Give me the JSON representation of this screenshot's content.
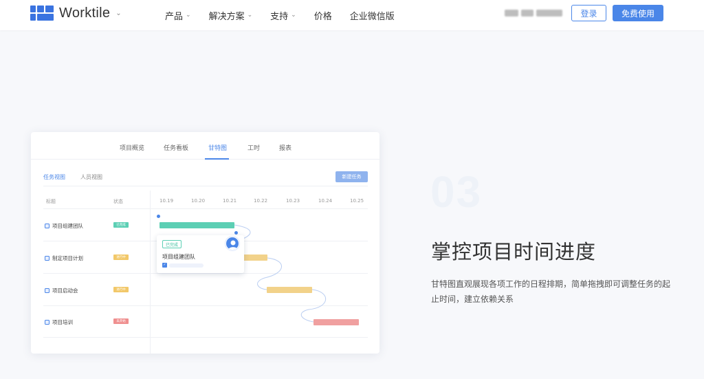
{
  "header": {
    "brand": "Worktile",
    "nav": [
      {
        "label": "产品",
        "has_menu": true
      },
      {
        "label": "解决方案",
        "has_menu": true
      },
      {
        "label": "支持",
        "has_menu": true
      },
      {
        "label": "价格",
        "has_menu": false
      },
      {
        "label": "企业微信版",
        "has_menu": false
      }
    ],
    "login_label": "登录",
    "free_label": "免费使用",
    "accent": "#4a86e8"
  },
  "card": {
    "tabs": [
      "项目概览",
      "任务看板",
      "甘特图",
      "工时",
      "报表"
    ],
    "active_tab": "甘特图",
    "views": [
      "任务视图",
      "人员视图"
    ],
    "active_view": "任务视图",
    "new_task_label": "新建任务",
    "columns": {
      "title": "标题",
      "status": "状态"
    },
    "dates": [
      "10.19",
      "10.20",
      "10.21",
      "10.22",
      "10.23",
      "10.24",
      "10.25"
    ],
    "tasks": [
      {
        "title": "项目组建团队",
        "status": "已完成",
        "status_color": "#5ccfb4",
        "bar_color": "#5ccfb4"
      },
      {
        "title": "制定项目计划",
        "status": "进行中",
        "status_color": "#f2c869",
        "bar_color": "#f2d28a"
      },
      {
        "title": "项目启动会",
        "status": "进行中",
        "status_color": "#f2c869",
        "bar_color": "#f2d28a"
      },
      {
        "title": "项目培训",
        "status": "未开始",
        "status_color": "#ef8f8f",
        "bar_color": "#f0a0a0"
      }
    ],
    "popup": {
      "status": "已完成",
      "title": "项目组建团队"
    }
  },
  "feature": {
    "number": "03",
    "headline": "掌控项目时间进度",
    "description": "甘特图直观展现各项工作的日程排期，简单拖拽即可调整任务的起止时间，建立依赖关系"
  }
}
